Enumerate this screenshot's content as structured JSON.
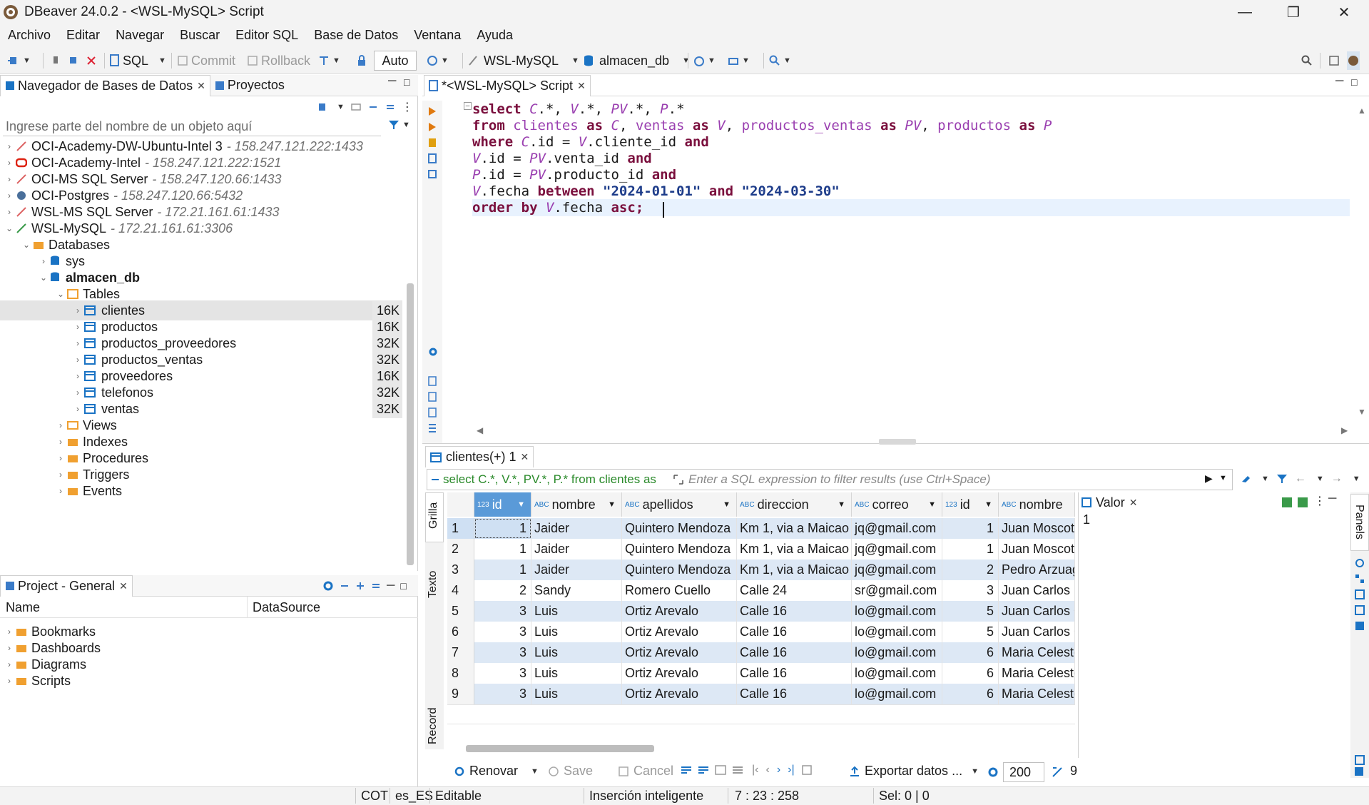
{
  "window": {
    "title": "DBeaver 24.0.2 - <WSL-MySQL> Script"
  },
  "menu": [
    "Archivo",
    "Editar",
    "Navegar",
    "Buscar",
    "Editor SQL",
    "Base de Datos",
    "Ventana",
    "Ayuda"
  ],
  "toolbar": {
    "sql_label": "SQL",
    "commit_label": "Commit",
    "rollback_label": "Rollback",
    "tx_mode": "Auto",
    "connection": "WSL-MySQL",
    "database": "almacen_db"
  },
  "navigator": {
    "tab_label": "Navegador de Bases de Datos",
    "projects_tab": "Proyectos",
    "filter_placeholder": "Ingrese parte del nombre de un objeto aquí",
    "connections": [
      {
        "name": "OCI-Academy-DW-Ubuntu-Intel 3",
        "addr": "- 158.247.121.222:1433"
      },
      {
        "name": "OCI-Academy-Intel",
        "addr": "- 158.247.121.222:1521"
      },
      {
        "name": "OCI-MS SQL Server",
        "addr": "- 158.247.120.66:1433"
      },
      {
        "name": "OCI-Postgres",
        "addr": "- 158.247.120.66:5432"
      },
      {
        "name": "WSL-MS SQL Server",
        "addr": "- 172.21.161.61:1433"
      },
      {
        "name": "WSL-MySQL",
        "addr": "- 172.21.161.61:3306"
      }
    ],
    "databases_label": "Databases",
    "sys_label": "sys",
    "db_label": "almacen_db",
    "tables_label": "Tables",
    "tables": [
      {
        "name": "clientes",
        "size": "16K"
      },
      {
        "name": "productos",
        "size": "16K"
      },
      {
        "name": "productos_proveedores",
        "size": "32K"
      },
      {
        "name": "productos_ventas",
        "size": "32K"
      },
      {
        "name": "proveedores",
        "size": "16K"
      },
      {
        "name": "telefonos",
        "size": "32K"
      },
      {
        "name": "ventas",
        "size": "32K"
      }
    ],
    "folders": [
      "Views",
      "Indexes",
      "Procedures",
      "Triggers",
      "Events"
    ]
  },
  "project": {
    "tab_label": "Project - General",
    "col_name": "Name",
    "col_datasource": "DataSource",
    "items": [
      "Bookmarks",
      "Dashboards",
      "Diagrams",
      "Scripts"
    ]
  },
  "editor": {
    "tab_label": "*<WSL-MySQL> Script",
    "lines": [
      [
        [
          "kw",
          "select "
        ],
        [
          "id",
          "C"
        ],
        [
          "plain",
          ".*, "
        ],
        [
          "id",
          "V"
        ],
        [
          "plain",
          ".*, "
        ],
        [
          "id",
          "PV"
        ],
        [
          "plain",
          ".*, "
        ],
        [
          "id",
          "P"
        ],
        [
          "plain",
          ".*"
        ]
      ],
      [
        [
          "kw",
          "from "
        ],
        [
          "tbl",
          "clientes "
        ],
        [
          "kw",
          "as "
        ],
        [
          "id",
          "C"
        ],
        [
          "plain",
          ", "
        ],
        [
          "tbl",
          "ventas "
        ],
        [
          "kw",
          "as "
        ],
        [
          "id",
          "V"
        ],
        [
          "plain",
          ", "
        ],
        [
          "tbl",
          "productos_ventas "
        ],
        [
          "kw",
          "as "
        ],
        [
          "id",
          "PV"
        ],
        [
          "plain",
          ", "
        ],
        [
          "tbl",
          "productos "
        ],
        [
          "kw",
          "as "
        ],
        [
          "id",
          "P"
        ]
      ],
      [
        [
          "kw",
          "where "
        ],
        [
          "id",
          "C"
        ],
        [
          "plain",
          ".id = "
        ],
        [
          "id",
          "V"
        ],
        [
          "plain",
          ".cliente_id "
        ],
        [
          "kw",
          "and"
        ]
      ],
      [
        [
          "id",
          "V"
        ],
        [
          "plain",
          ".id = "
        ],
        [
          "id",
          "PV"
        ],
        [
          "plain",
          ".venta_id "
        ],
        [
          "kw",
          "and"
        ]
      ],
      [
        [
          "id",
          "P"
        ],
        [
          "plain",
          ".id = "
        ],
        [
          "id",
          "PV"
        ],
        [
          "plain",
          ".producto_id "
        ],
        [
          "kw",
          "and"
        ]
      ],
      [
        [
          "id",
          "V"
        ],
        [
          "plain",
          ".fecha "
        ],
        [
          "kw",
          "between "
        ],
        [
          "str",
          "\"2024-01-01\" "
        ],
        [
          "kw",
          "and "
        ],
        [
          "str",
          "\"2024-03-30\""
        ]
      ],
      [
        [
          "kw",
          "order by "
        ],
        [
          "id",
          "V"
        ],
        [
          "plain",
          ".fecha "
        ],
        [
          "kw",
          "asc; "
        ]
      ]
    ]
  },
  "results": {
    "tab_label": "clientes(+) 1",
    "query_preview": "select C.*, V.*, PV.*, P.* from clientes as",
    "filter_placeholder": "Enter a SQL expression to filter results (use Ctrl+Space)",
    "side_tabs": [
      "Grilla",
      "Texto",
      "Record"
    ],
    "columns": [
      "id",
      "nombre",
      "apellidos",
      "direccion",
      "correo",
      "id",
      "nombre"
    ],
    "rows": [
      [
        "1",
        "1",
        "Jaider",
        "Quintero Mendoza",
        "Km 1, via a Maicao",
        "jq@gmail.com",
        "1",
        "Juan Moscote"
      ],
      [
        "2",
        "1",
        "Jaider",
        "Quintero Mendoza",
        "Km 1, via a Maicao",
        "jq@gmail.com",
        "1",
        "Juan Moscote"
      ],
      [
        "3",
        "1",
        "Jaider",
        "Quintero Mendoza",
        "Km 1, via a Maicao",
        "jq@gmail.com",
        "2",
        "Pedro Arzuaga"
      ],
      [
        "4",
        "2",
        "Sandy",
        "Romero Cuello",
        "Calle 24",
        "sr@gmail.com",
        "3",
        "Juan Carlos M"
      ],
      [
        "5",
        "3",
        "Luis",
        "Ortiz Arevalo",
        "Calle 16",
        "lo@gmail.com",
        "5",
        "Juan Carlos G"
      ],
      [
        "6",
        "3",
        "Luis",
        "Ortiz Arevalo",
        "Calle 16",
        "lo@gmail.com",
        "5",
        "Juan Carlos G"
      ],
      [
        "7",
        "3",
        "Luis",
        "Ortiz Arevalo",
        "Calle 16",
        "lo@gmail.com",
        "6",
        "Maria Celeste"
      ],
      [
        "8",
        "3",
        "Luis",
        "Ortiz Arevalo",
        "Calle 16",
        "lo@gmail.com",
        "6",
        "Maria Celeste"
      ],
      [
        "9",
        "3",
        "Luis",
        "Ortiz Arevalo",
        "Calle 16",
        "lo@gmail.com",
        "6",
        "Maria Celeste"
      ]
    ],
    "value_panel_label": "Valor",
    "value_panel_content": "1",
    "panels_label": "Panels",
    "refresh_label": "Renovar",
    "save_label": "Save",
    "cancel_label": "Cancel",
    "export_label": "Exportar datos ...",
    "fetch_size": "200",
    "row_count": "9"
  },
  "statusbar": {
    "tz": "COT",
    "locale": "es_ES",
    "mode": "Editable",
    "insert": "Inserción inteligente",
    "position": "7 : 23 : 258",
    "selection": "Sel: 0 | 0"
  },
  "colors": {
    "accent": "#1a73c4",
    "selection_row": "#cfe0f3",
    "keyword": "#7a0f3d",
    "alias": "#9a3fb0",
    "string": "#1d3c8a"
  }
}
